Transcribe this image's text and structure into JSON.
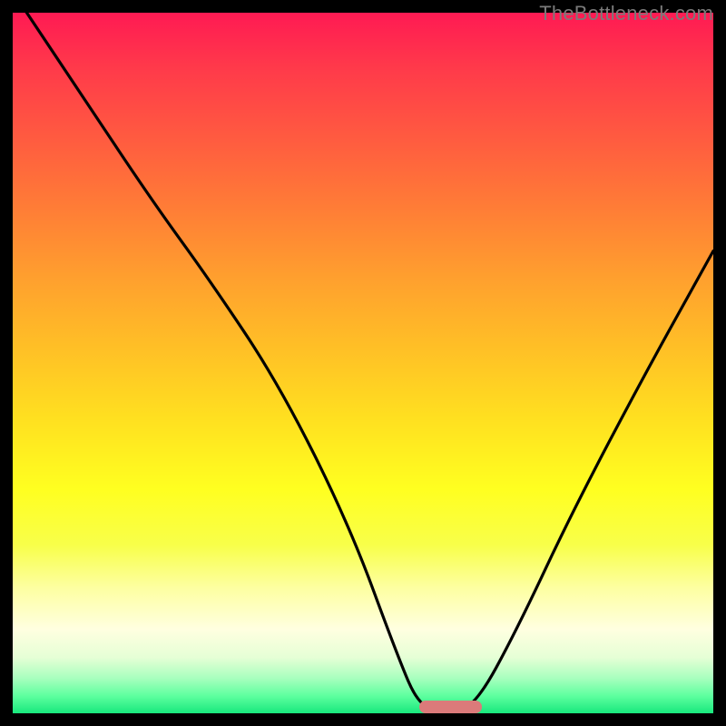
{
  "watermark": "TheBottleneck.com",
  "colors": {
    "frame_bg": "#000000",
    "curve_stroke": "#000000",
    "marker_fill": "#db7a7a",
    "gradient_top": "#ff1a53",
    "gradient_bottom": "#18e87d"
  },
  "chart_data": {
    "type": "line",
    "title": "",
    "xlabel": "",
    "ylabel": "",
    "xlim": [
      0,
      100
    ],
    "ylim": [
      0,
      100
    ],
    "grid": false,
    "legend": false,
    "x": [
      0,
      10,
      20,
      28,
      38,
      48,
      55,
      58,
      62,
      66,
      72,
      80,
      90,
      100
    ],
    "values": [
      103,
      88,
      73,
      62,
      47,
      27,
      8,
      1,
      0,
      1,
      12,
      29,
      48,
      66
    ],
    "marker": {
      "x_start": 58,
      "x_end": 67,
      "y": 0
    }
  }
}
